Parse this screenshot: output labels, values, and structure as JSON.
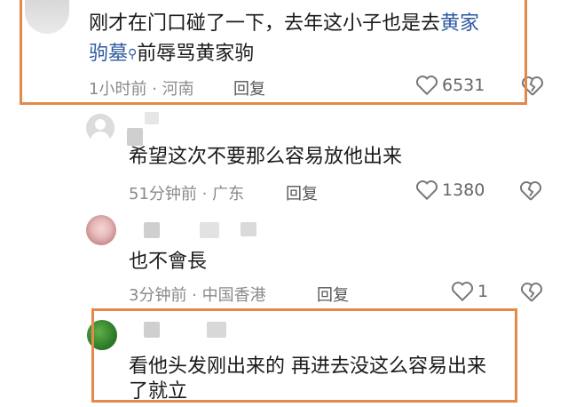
{
  "comments": [
    {
      "text_line1": "刚才在门口碰了一下，去年这小子也是去",
      "link_part1": "黄家",
      "link_part2": "驹墓",
      "text_line2": "前辱骂黄家驹",
      "time_loc": "1小时前 · 河南",
      "reply": "回复",
      "likes": "6531"
    },
    {
      "text": "希望这次不要那么容易放他出来",
      "time_loc": "51分钟前 · 广东",
      "reply": "回复",
      "likes": "1380"
    },
    {
      "text": "也不會長",
      "time_loc": "3分钟前 · 中国香港",
      "reply": "回复",
      "likes": "1"
    },
    {
      "text": "看他头发刚出来的 再进去没这么容易出来",
      "text_line2": "了就立"
    }
  ],
  "colors": {
    "highlight": "#e38a4a",
    "link": "#2d5aa0"
  }
}
